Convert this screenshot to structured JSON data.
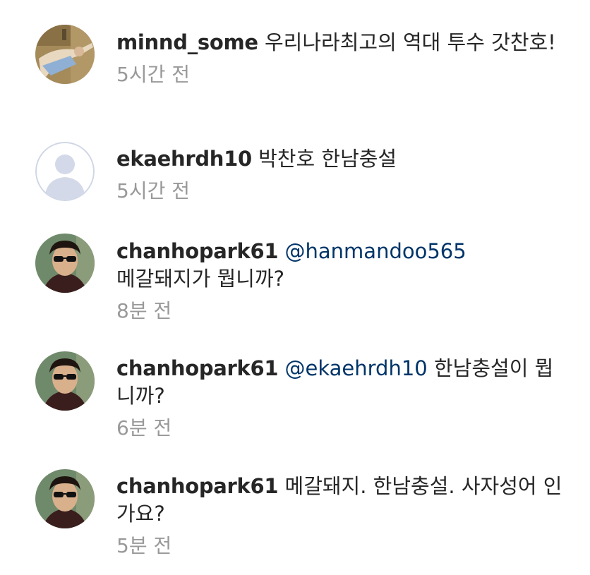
{
  "comments": [
    {
      "username": "minnd_some",
      "mention": "",
      "text": "우리나라최고의 역대 투수 갓찬호!",
      "timestamp": "5시간 전",
      "avatar_icon": "photo-avatar"
    },
    {
      "username": "ekaehrdh10",
      "mention": "",
      "text": "박찬호 한남충설",
      "timestamp": "5시간 전",
      "avatar_icon": "default-user-icon"
    },
    {
      "username": "chanhopark61",
      "mention": "@hanmandoo565",
      "text": "메갈돼지가 뭡니까?",
      "timestamp": "8분 전",
      "avatar_icon": "photo-avatar"
    },
    {
      "username": "chanhopark61",
      "mention": "@ekaehrdh10",
      "text": "한남충설이 뭡니까?",
      "timestamp": "6분 전",
      "avatar_icon": "photo-avatar"
    },
    {
      "username": "chanhopark61",
      "mention": "",
      "text": "메갈돼지. 한남충설. 사자성어 인가요?",
      "timestamp": "5분 전",
      "avatar_icon": "photo-avatar"
    }
  ],
  "colors": {
    "username": "#262626",
    "text": "#262626",
    "mention": "#003569",
    "timestamp": "#999999"
  }
}
